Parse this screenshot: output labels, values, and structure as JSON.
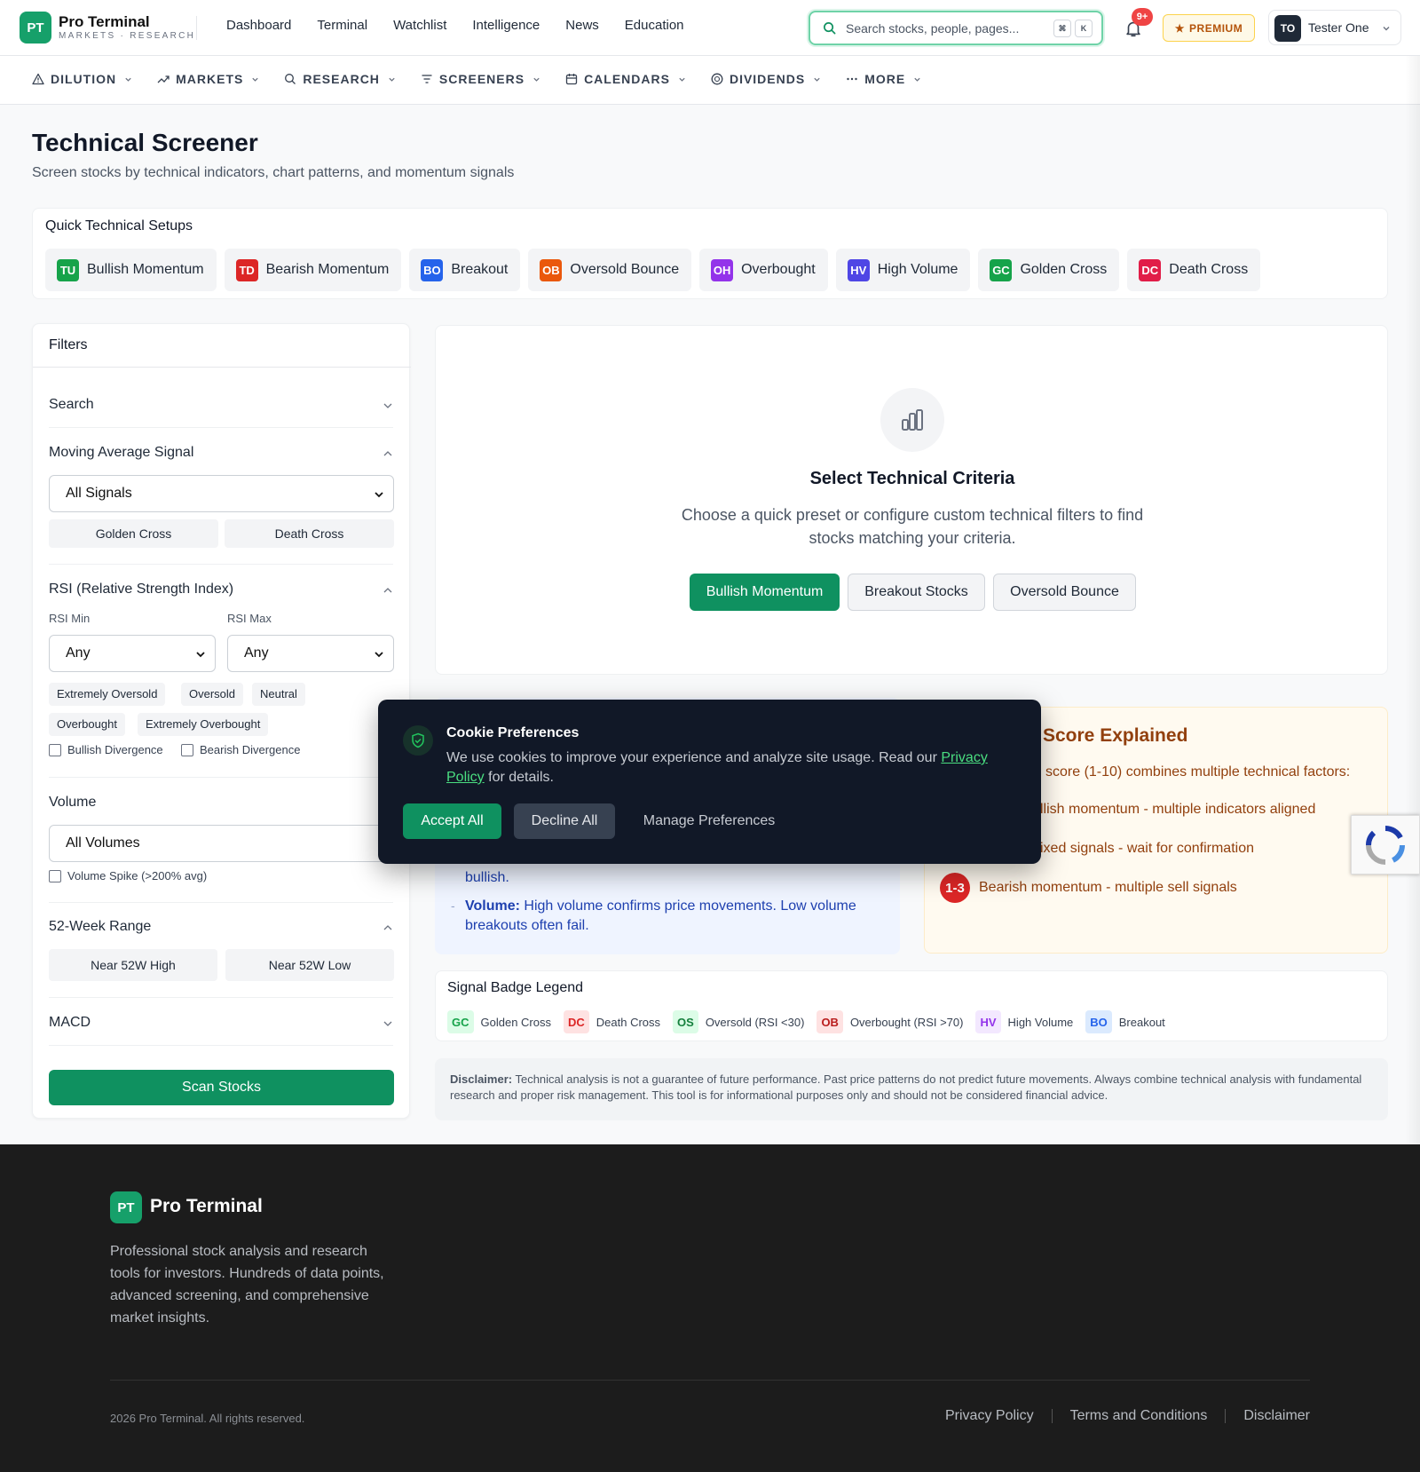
{
  "brand": {
    "logo": "PT",
    "name": "Pro Terminal",
    "tagline": "MARKETS · RESEARCH"
  },
  "topnav": [
    "Dashboard",
    "Terminal",
    "Watchlist",
    "Intelligence",
    "News",
    "Education"
  ],
  "search": {
    "placeholder": "Search stocks, people, pages...",
    "kbd1": "⌘",
    "kbd2": "K"
  },
  "notifications": {
    "badge": "9+"
  },
  "premium": {
    "star": "★",
    "label": "PREMIUM"
  },
  "user": {
    "initials": "TO",
    "name": "Tester One"
  },
  "subnav": [
    {
      "label": "DILUTION",
      "icon": "warning-icon"
    },
    {
      "label": "MARKETS",
      "icon": "trend-icon"
    },
    {
      "label": "RESEARCH",
      "icon": "search-icon"
    },
    {
      "label": "SCREENERS",
      "icon": "filter-icon"
    },
    {
      "label": "CALENDARS",
      "icon": "calendar-icon"
    },
    {
      "label": "DIVIDENDS",
      "icon": "coin-icon"
    },
    {
      "label": "MORE",
      "icon": "dots-icon"
    }
  ],
  "page": {
    "title": "Technical Screener",
    "subtitle": "Screen stocks by technical indicators, chart patterns, and momentum signals"
  },
  "quick_setups": {
    "title": "Quick Technical Setups",
    "items": [
      {
        "tag": "TU",
        "label": "Bullish Momentum",
        "color": "#16a34a"
      },
      {
        "tag": "TD",
        "label": "Bearish Momentum",
        "color": "#dc2626"
      },
      {
        "tag": "BO",
        "label": "Breakout",
        "color": "#2563eb"
      },
      {
        "tag": "OB",
        "label": "Oversold Bounce",
        "color": "#ea580c"
      },
      {
        "tag": "OH",
        "label": "Overbought",
        "color": "#9333ea"
      },
      {
        "tag": "HV",
        "label": "High Volume",
        "color": "#4f46e5"
      },
      {
        "tag": "GC",
        "label": "Golden Cross",
        "color": "#16a34a"
      },
      {
        "tag": "DC",
        "label": "Death Cross",
        "color": "#e11d48"
      }
    ]
  },
  "filters": {
    "title": "Filters",
    "search_label": "Search",
    "ma": {
      "label": "Moving Average Signal",
      "select": "All Signals",
      "btn1": "Golden Cross",
      "btn2": "Death Cross"
    },
    "rsi": {
      "label": "RSI (Relative Strength Index)",
      "min_label": "RSI Min",
      "max_label": "RSI Max",
      "min_val": "Any",
      "max_val": "Any",
      "pills": [
        "Extremely Oversold",
        "Oversold",
        "Neutral",
        "Overbought",
        "Extremely Overbought"
      ],
      "cb1": "Bullish Divergence",
      "cb2": "Bearish Divergence"
    },
    "volume": {
      "label": "Volume",
      "select": "All Volumes",
      "cb": "Volume Spike (>200% avg)"
    },
    "week52": {
      "label": "52-Week Range",
      "btn1": "Near 52W High",
      "btn2": "Near 52W Low"
    },
    "macd_label": "MACD",
    "scan": "Scan Stocks"
  },
  "empty_state": {
    "title": "Select Technical Criteria",
    "text": "Choose a quick preset or configure custom technical filters to find stocks matching your criteria.",
    "buttons": [
      "Bullish Momentum",
      "Breakout Stocks",
      "Oversold Bounce"
    ]
  },
  "tips": {
    "line1": "bullish.",
    "vol_bold": "Volume:",
    "vol_text": " High volume confirms price movements. Low volume breakouts often fail."
  },
  "score": {
    "title": "Score Explained",
    "intro": "score (1-10) combines multiple technical factors:",
    "l1": "llish momentum - multiple indicators aligned",
    "l2": "ixed signals - wait for confirmation",
    "badge3": "1-3",
    "l3": "Bearish momentum - multiple sell signals"
  },
  "legend": {
    "title": "Signal Badge Legend",
    "items": [
      {
        "tag": "GC",
        "label": "Golden Cross",
        "fg": "#16a34a",
        "bg": "#dcfce7"
      },
      {
        "tag": "DC",
        "label": "Death Cross",
        "fg": "#dc2626",
        "bg": "#fee2e2"
      },
      {
        "tag": "OS",
        "label": "Oversold (RSI <30)",
        "fg": "#15803d",
        "bg": "#dcfce7"
      },
      {
        "tag": "OB",
        "label": "Overbought (RSI >70)",
        "fg": "#b91c1c",
        "bg": "#fee2e2"
      },
      {
        "tag": "HV",
        "label": "High Volume",
        "fg": "#9333ea",
        "bg": "#f3e8ff"
      },
      {
        "tag": "BO",
        "label": "Breakout",
        "fg": "#2563eb",
        "bg": "#dbeafe"
      }
    ]
  },
  "disclaimer": {
    "bold": "Disclaimer:",
    "text": " Technical analysis is not a guarantee of future performance. Past price patterns do not predict future movements. Always combine technical analysis with fundamental research and proper risk management. This tool is for informational purposes only and should not be considered financial advice."
  },
  "cookie": {
    "title": "Cookie Preferences",
    "text": "We use cookies to improve your experience and analyze site usage. Read our ",
    "link": "Privacy Policy",
    "text2": " for details.",
    "accept": "Accept All",
    "decline": "Decline All",
    "manage": "Manage Preferences"
  },
  "footer": {
    "logo": "PT",
    "name": "Pro Terminal",
    "desc": "Professional stock analysis and research tools for investors. Hundreds of data points, advanced screening, and comprehensive market insights.",
    "copy": "2026 Pro Terminal. All rights reserved.",
    "links": [
      "Privacy Policy",
      "Terms and Conditions",
      "Disclaimer"
    ]
  }
}
